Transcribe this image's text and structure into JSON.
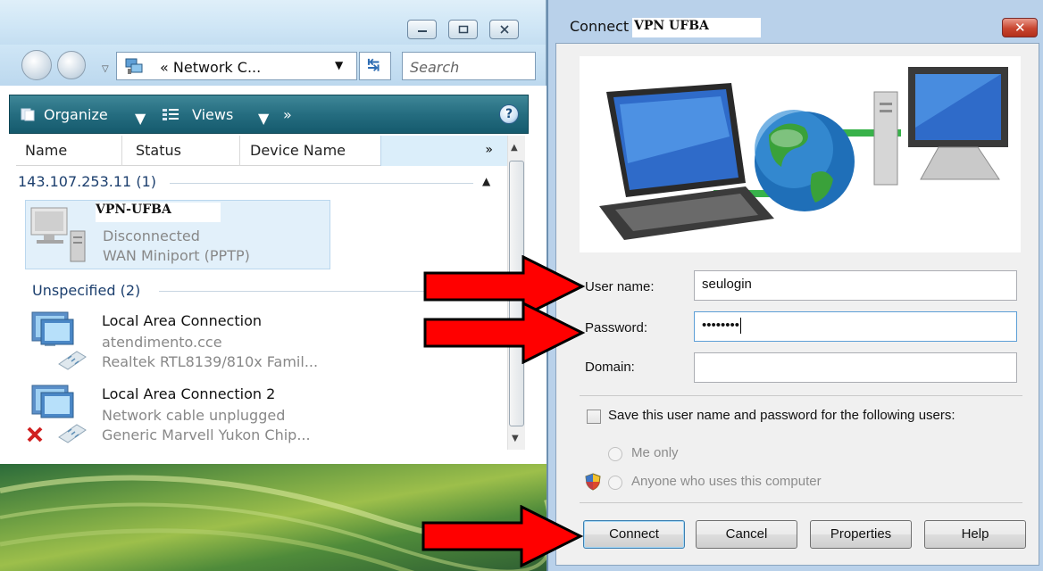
{
  "explorer": {
    "address": "« Network C...",
    "search_placeholder": "Search",
    "toolbar": {
      "organize": "Organize",
      "views": "Views"
    },
    "columns": [
      "Name",
      "Status",
      "Device Name"
    ],
    "groups": [
      {
        "header": "143.107.253.11 (1)",
        "items": [
          {
            "name": "VPN-UFBA",
            "status": "Disconnected",
            "device": "WAN Miniport (PPTP)"
          }
        ]
      },
      {
        "header": "Unspecified (2)",
        "items": [
          {
            "name": "Local Area Connection",
            "status": "atendimento.cce",
            "device": "Realtek RTL8139/810x Famil..."
          },
          {
            "name": "Local Area Connection 2",
            "status": "Network cable unplugged",
            "device": "Generic Marvell Yukon Chip..."
          }
        ]
      }
    ]
  },
  "dialog": {
    "title_prefix": "Connect",
    "title_name": "VPN UFBA",
    "user_label": "User name:",
    "user_value": "seulogin",
    "password_label": "Password:",
    "password_mask": "••••••••",
    "domain_label": "Domain:",
    "domain_value": "",
    "save_label": "Save this user name and password for the following users:",
    "radio_me": "Me only",
    "radio_anyone": "Anyone who uses this computer",
    "buttons": {
      "connect": "Connect",
      "cancel": "Cancel",
      "properties": "Properties",
      "help": "Help"
    }
  },
  "colors": {
    "toolbar": "#256d80",
    "arrow": "#ff0000",
    "dialog_frame": "#b9d1ea",
    "selected_item": "#e2f0fa"
  }
}
